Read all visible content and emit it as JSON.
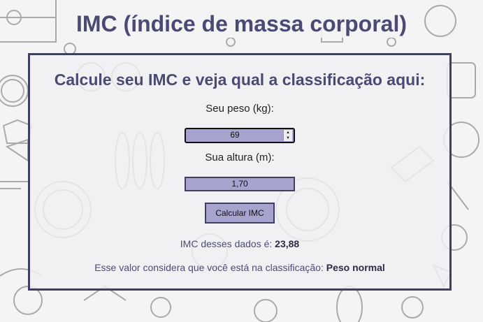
{
  "header": {
    "title": "IMC (índice de massa corporal)"
  },
  "form": {
    "heading": "Calcule seu IMC e veja qual a classificação aqui:",
    "weight_label": "Seu peso (kg):",
    "weight_value": "69",
    "height_label": "Sua altura (m):",
    "height_value": "1,70",
    "button_label": "Calcular IMC"
  },
  "result": {
    "imc_prefix": "IMC desses dados é: ",
    "imc_value": "23,88",
    "class_prefix": "Esse valor considera que você está na classificação: ",
    "class_value": "Peso normal"
  },
  "colors": {
    "accent": "#4a4a75",
    "input_fill": "#a7a3cf",
    "border": "#3f3f62"
  }
}
